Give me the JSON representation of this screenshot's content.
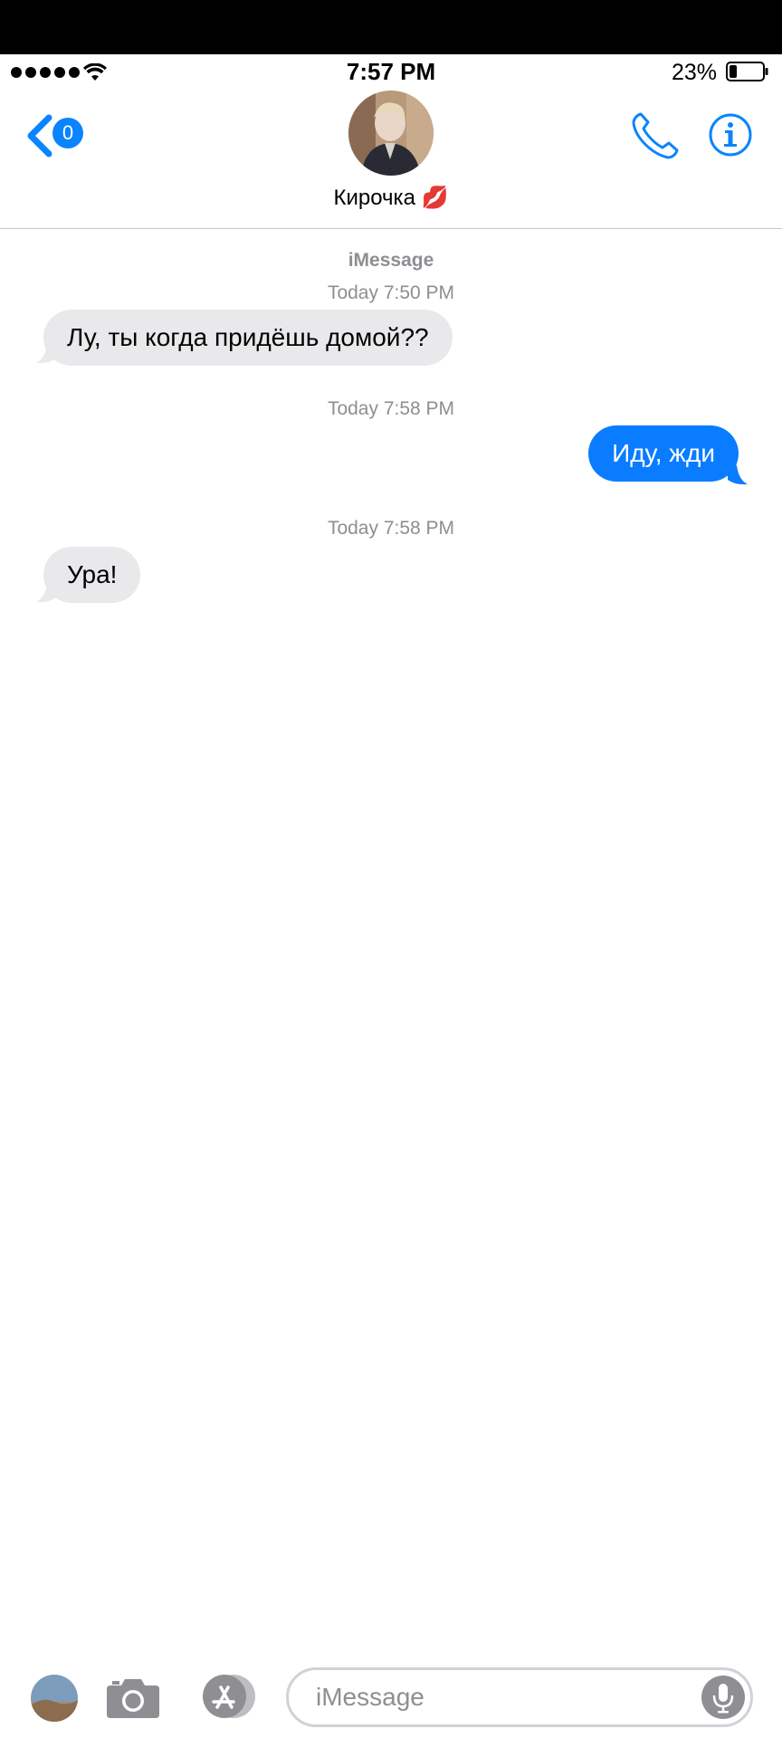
{
  "status_bar": {
    "time": "7:57 PM",
    "battery_percent": "23%",
    "battery_level": 0.23,
    "signal_bars": 5
  },
  "header": {
    "back_badge": "0",
    "contact_name": "Кирочка 💋"
  },
  "conversation": {
    "service": "iMessage",
    "messages": [
      {
        "timestamp": "Today 7:50 PM",
        "direction": "incoming",
        "text": "Лу, ты когда придёшь домой??"
      },
      {
        "timestamp": "Today 7:58 PM",
        "direction": "outgoing",
        "text": "Иду, жди"
      },
      {
        "timestamp": "Today 7:58 PM",
        "direction": "incoming",
        "text": "Ура!"
      }
    ]
  },
  "composer": {
    "placeholder": "iMessage"
  },
  "colors": {
    "accent": "#0a84ff",
    "outgoing_bubble": "#0a7cff",
    "incoming_bubble": "#e9e9eb",
    "secondary_text": "#8e8e93"
  },
  "icons": {
    "back": "chevron-left-icon",
    "call": "phone-icon",
    "info": "info-icon",
    "camera": "camera-icon",
    "appstore": "app-store-icon",
    "mic": "microphone-icon",
    "wifi": "wifi-icon",
    "battery": "battery-icon"
  }
}
